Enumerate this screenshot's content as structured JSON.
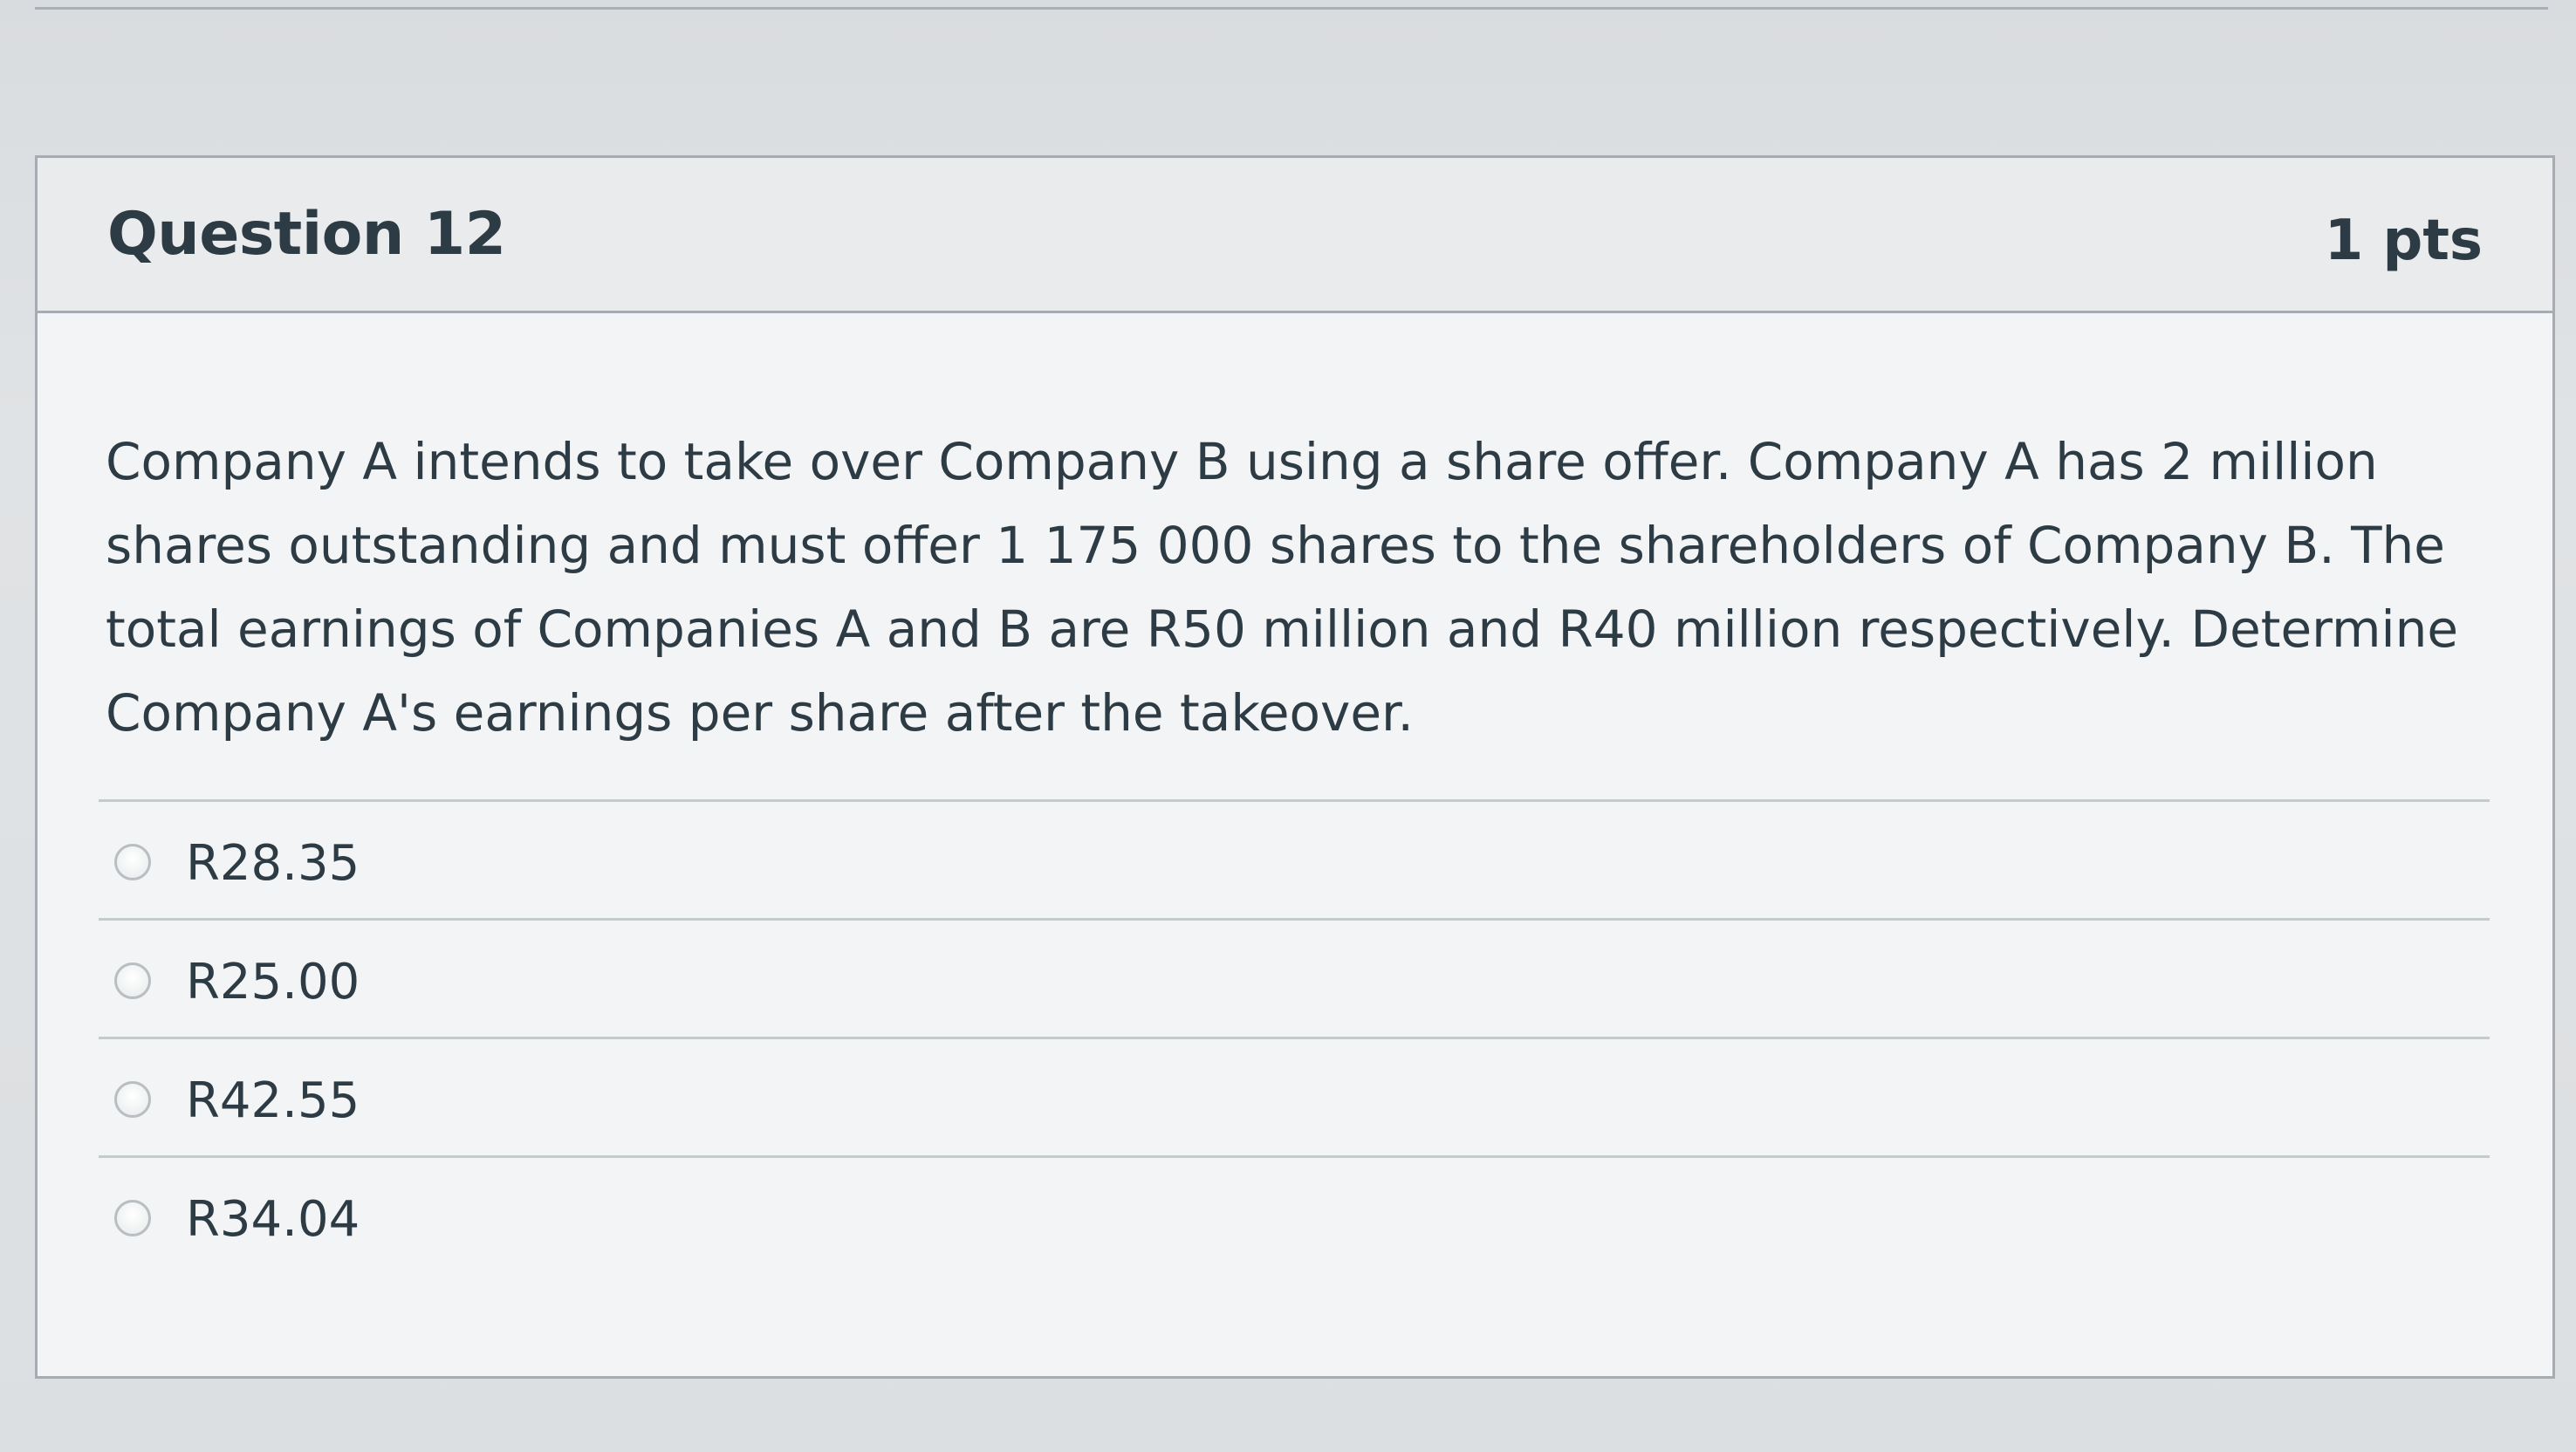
{
  "question": {
    "title": "Question 12",
    "points": "1 pts",
    "text": "Company A intends to take over Company B using a share offer. Company A has 2  million shares outstanding and must offer 1 175 000 shares to the shareholders of Company B. The total earnings of Companies A and B are R50 million and R40 million respectively. Determine Company A's earnings per share after the takeover.",
    "answers": [
      {
        "label": "R28.35"
      },
      {
        "label": "R25.00"
      },
      {
        "label": "R42.55"
      },
      {
        "label": "R34.04"
      }
    ]
  },
  "colors": {
    "text": "#2d3b45",
    "header_bg": "#e9ebed",
    "border": "#a6acb1"
  }
}
